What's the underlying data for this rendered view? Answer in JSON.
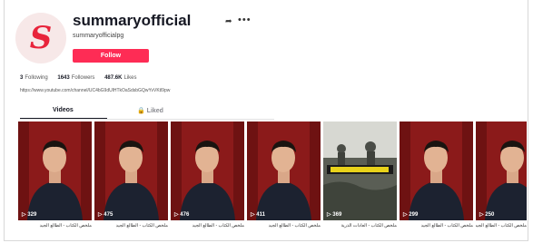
{
  "profile": {
    "username": "summaryofficial",
    "nickname": "summaryofficialpg",
    "follow_label": "Follow",
    "bio_link": "https://www.youtube.com/channel/UC4bG9dUlHTkOaSdsbGQwYvVKtl9pw"
  },
  "stats": [
    {
      "value": "3",
      "label": "Following"
    },
    {
      "value": "1643",
      "label": "Followers"
    },
    {
      "value": "487.6K",
      "label": "Likes"
    }
  ],
  "tabs": {
    "videos": "Videos",
    "liked": "Liked"
  },
  "icons": {
    "share": "share-icon",
    "more": "more-icon",
    "play": "play-icon",
    "lock": "lock-icon"
  },
  "colors": {
    "accent": "#fe2c55",
    "brand_red": "#e8243b",
    "curtain_red": "#8b1a1a"
  },
  "videos": [
    {
      "views": "329",
      "caption": "ملخص الكتاب - الطالع الجيد"
    },
    {
      "views": "475",
      "caption": "ملخص الكتاب - الطالع الجيد"
    },
    {
      "views": "476",
      "caption": "ملخص الكتاب - الطالع الجيد"
    },
    {
      "views": "411",
      "caption": "ملخص الكتاب - الطالع الجيد"
    },
    {
      "views": "369",
      "caption": "ملخص الكتاب - العادات الذرية"
    },
    {
      "views": "299",
      "caption": "ملخص الكتاب - الطالع الجيد"
    },
    {
      "views": "250",
      "caption": "ملخص الكتاب - الطالع الجيد"
    }
  ]
}
